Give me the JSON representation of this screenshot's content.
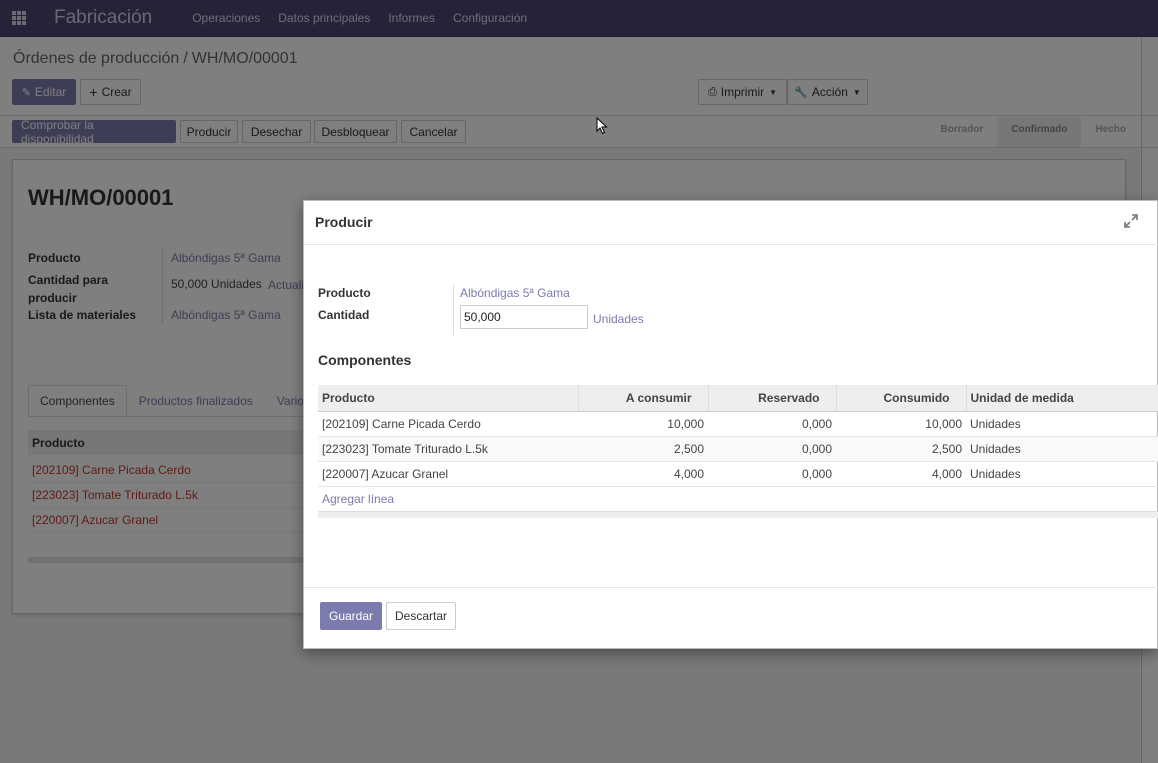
{
  "navbar": {
    "app_name": "Fabricación",
    "menu": [
      "Operaciones",
      "Datos principales",
      "Informes",
      "Configuración"
    ]
  },
  "breadcrumb": {
    "parent": "Órdenes de producción",
    "separator": "/",
    "current": "WH/MO/00001"
  },
  "control": {
    "edit": "Editar",
    "create": "Crear",
    "print": "Imprimir",
    "action": "Acción"
  },
  "statusbar": {
    "buttons": [
      "Comprobar la disponibilidad",
      "Producir",
      "Desechar",
      "Desbloquear",
      "Cancelar"
    ],
    "steps": [
      "Borrador",
      "Confirmado",
      "Hecho"
    ],
    "active_step": "Confirmado"
  },
  "form": {
    "title": "WH/MO/00001",
    "product_label": "Producto",
    "product_value": "Albóndigas 5ª Gama",
    "qty_label_line1": "Cantidad para",
    "qty_label_line2": "producir",
    "qty_value": "50,000 Unidades",
    "qty_update_link": "Actuali",
    "bom_label": "Lista de materiales",
    "bom_value": "Albóndigas 5ª Gama",
    "tabs": [
      "Componentes",
      "Productos finalizados",
      "Varios"
    ],
    "table_header": "Producto",
    "rows": [
      "[202109] Carne Picada Cerdo",
      "[223023] Tomate Triturado L.5k",
      "[220007] Azucar Granel"
    ]
  },
  "modal": {
    "title": "Producir",
    "product_label": "Producto",
    "product_value": "Albóndigas 5ª Gama",
    "qty_label": "Cantidad",
    "qty_value": "50,000",
    "qty_uom": "Unidades",
    "section_title": "Componentes",
    "columns": [
      "Producto",
      "A consumir",
      "Reservado",
      "Consumido",
      "Unidad de medida"
    ],
    "rows": [
      {
        "product": "[202109] Carne Picada Cerdo",
        "to_consume": "10,000",
        "reserved": "0,000",
        "consumed": "10,000",
        "uom": "Unidades"
      },
      {
        "product": "[223023] Tomate Triturado L.5k",
        "to_consume": "2,500",
        "reserved": "0,000",
        "consumed": "2,500",
        "uom": "Unidades"
      },
      {
        "product": "[220007] Azucar Granel",
        "to_consume": "4,000",
        "reserved": "0,000",
        "consumed": "4,000",
        "uom": "Unidades"
      }
    ],
    "add_line": "Agregar línea",
    "save": "Guardar",
    "discard": "Descartar"
  },
  "colors": {
    "navbar": "#4a466e",
    "primary": "#7c7bad",
    "link": "#7c7bad",
    "red_row": "#c0392b"
  }
}
